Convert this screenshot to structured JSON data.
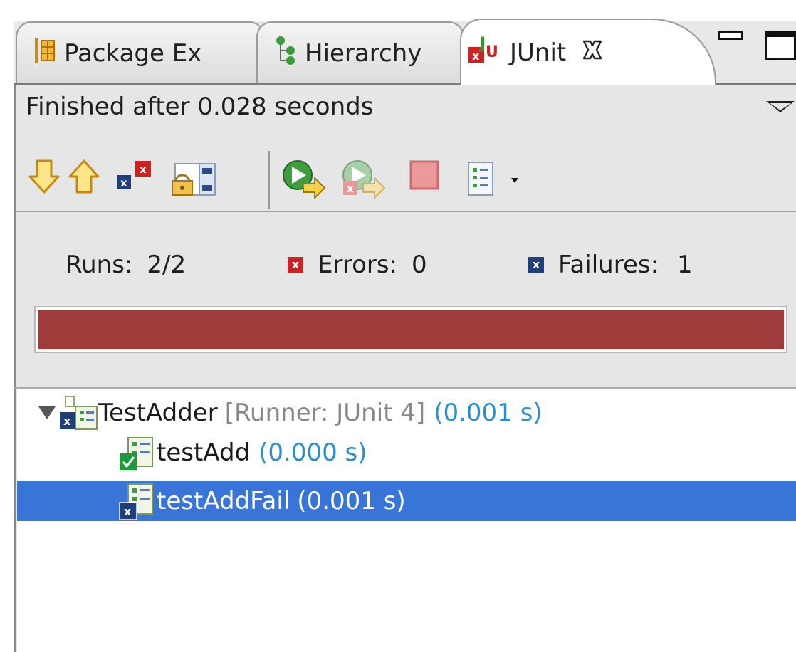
{
  "tabs": [
    {
      "label": "Package Ex",
      "icon": "package-explorer-icon"
    },
    {
      "label": "Hierarchy",
      "icon": "hierarchy-icon"
    },
    {
      "label": "JUnit",
      "icon": "junit-icon",
      "close_icon": "close-icon"
    }
  ],
  "window_controls": {
    "minimize_icon": "minimize-icon",
    "maximize_icon": "maximize-icon"
  },
  "status_text": "Finished after 0.028 seconds",
  "toolbar": {
    "icons": [
      "next-failure-icon",
      "previous-failure-icon",
      "show-failures-only-icon",
      "scroll-lock-icon",
      "rerun-test-icon",
      "rerun-failed-first-icon",
      "stop-icon",
      "test-run-history-icon"
    ]
  },
  "counters": {
    "runs_label": "Runs:",
    "runs_value": "2/2",
    "errors_label": "Errors:",
    "errors_value": "0",
    "failures_label": "Failures:",
    "failures_value": "1"
  },
  "progress": {
    "fraction": 1.0,
    "color": "#9e3c3c"
  },
  "tree": {
    "root": {
      "name": "TestAdder",
      "runner": "[Runner: JUnit 4]",
      "time": "(0.001 s)",
      "status": "failed"
    },
    "children": [
      {
        "name": "testAdd",
        "time": "(0.000 s)",
        "status": "passed"
      },
      {
        "name": "testAddFail",
        "time": "(0.001 s)",
        "status": "failed",
        "selected": true
      }
    ]
  },
  "colors": {
    "selection": "#3875d7",
    "error_red": "#cc2222",
    "failure_blue": "#1f3f7a",
    "pass_green": "#1e9a3a",
    "time_blue": "#2a8fd0"
  }
}
